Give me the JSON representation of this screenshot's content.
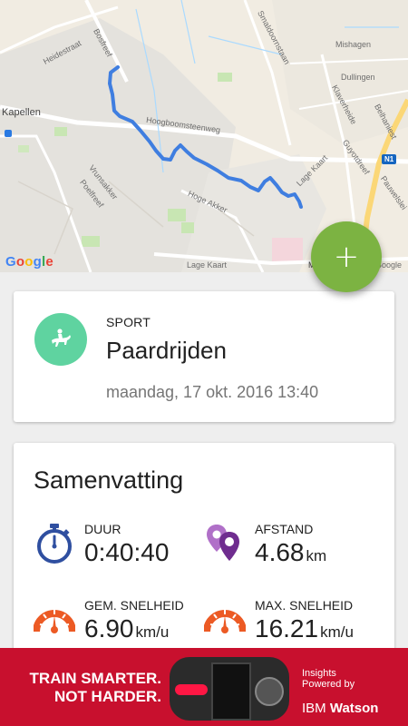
{
  "map": {
    "labels": {
      "heidestraat": "Heidestraat",
      "boshoek": "Bosfreef",
      "kapellen": "Kapellen",
      "hoogboom": "Hoogboomsteenweg",
      "vrunsakker": "Vrunsakker",
      "poelstraat": "Poelfreef",
      "hoge_akker": "Hoge Akker",
      "lage_kaart_top": "Lage Kaart",
      "lage_kaart_bottom": "Lage Kaart",
      "smaldoorn": "Smaldoornstaan",
      "mishagen": "Mishagen",
      "dulingen": "Dullingen",
      "klaverheide": "Klaverheide",
      "belhaniest": "Belhaniest",
      "guyotdreef": "Guyotdreef",
      "pauwelslei": "Pauwelslei",
      "road_badge": "N1",
      "m_label": "M",
      "google_right": "Google"
    },
    "google_logo_letters": [
      "G",
      "o",
      "o",
      "g",
      "l",
      "e"
    ],
    "route_color": "#3f7ee0"
  },
  "fab": {
    "label": "+",
    "color": "#7cb342"
  },
  "sport_card": {
    "icon": "horse-rider-icon",
    "category_label": "SPORT",
    "activity_name": "Paardrijden",
    "date_time": "maandag, 17 okt. 2016 13:40"
  },
  "summary": {
    "title": "Samenvatting",
    "stats": {
      "duration": {
        "icon": "stopwatch-icon",
        "label": "DUUR",
        "value": "0:40:40",
        "unit": ""
      },
      "distance": {
        "icon": "map-pins-icon",
        "label": "AFSTAND",
        "value": "4.68",
        "unit": "km"
      },
      "avg_speed": {
        "icon": "speedometer-icon",
        "label": "GEM. SNELHEID",
        "value": "6.90",
        "unit": "km/u"
      },
      "max_speed": {
        "icon": "speedometer-icon",
        "label": "MAX. SNELHEID",
        "value": "16.21",
        "unit": "km/u"
      }
    }
  },
  "ad": {
    "headline_line1": "TRAIN SMARTER.",
    "headline_line2": "NOT HARDER.",
    "insights_line1": "Insights",
    "insights_line2": "Powered by",
    "ibm_prefix": "IBM",
    "ibm_brand": "Watson",
    "background": "#c8102e"
  }
}
